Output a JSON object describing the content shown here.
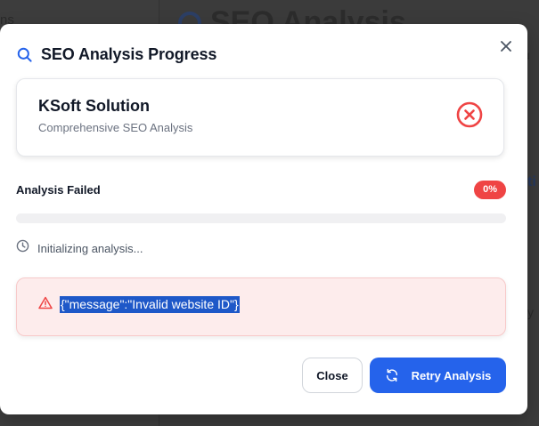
{
  "background": {
    "sidebar_text": "ns",
    "page_title": "SEO Analysis",
    "right_text_1": "u",
    "right_text_2": "ti",
    "right_text_3": "y"
  },
  "modal": {
    "title": "SEO Analysis Progress",
    "close_symbol": "×"
  },
  "site": {
    "name": "KSoft Solution",
    "subtitle": "Comprehensive SEO Analysis"
  },
  "status": {
    "label": "Analysis Failed",
    "percent": "0%",
    "progress_fraction": 0
  },
  "step": {
    "text": "Initializing analysis..."
  },
  "error": {
    "message": "{\"message\":\"Invalid website ID\"}"
  },
  "buttons": {
    "close_label": "Close",
    "retry_label": "Retry Analysis"
  },
  "colors": {
    "accent": "#2563eb",
    "danger": "#ef4444",
    "error_bg": "#fdecec"
  }
}
